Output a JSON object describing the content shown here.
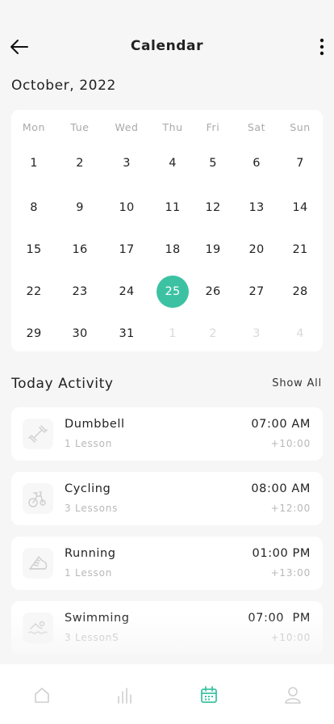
{
  "header": {
    "title": "Calendar",
    "back_icon": "arrow-left-icon",
    "menu_icon": "more-vertical-icon"
  },
  "calendar": {
    "month_label": "October, 2022",
    "weekdays": [
      "Mon",
      "Tue",
      "Wed",
      "Thu",
      "Fri",
      "Sat",
      "Sun"
    ],
    "weeks": [
      [
        "1",
        "2",
        "3",
        "4",
        "5",
        "6",
        "7"
      ],
      [
        "8",
        "9",
        "10",
        "11",
        "12",
        "13",
        "14"
      ],
      [
        "15",
        "16",
        "17",
        "18",
        "19",
        "20",
        "21"
      ],
      [
        "22",
        "23",
        "24",
        "25",
        "26",
        "27",
        "28"
      ],
      [
        "29",
        "30",
        "31",
        "1",
        "2",
        "3",
        "4"
      ]
    ],
    "next_month_days": [
      "1",
      "2",
      "3",
      "4"
    ],
    "selected_day": "25",
    "accent_color": "#3cc2a3"
  },
  "activity": {
    "title": "Today Activity",
    "show_all_label": "Show All",
    "items": [
      {
        "name": "Dumbbell",
        "sub": "1 Lesson",
        "time": "07:00 AM",
        "offset": "+10:00",
        "icon": "dumbbell-icon"
      },
      {
        "name": "Cycling",
        "sub": "3 Lessons",
        "time": "08:00 AM",
        "offset": "+12:00",
        "icon": "bike-icon"
      },
      {
        "name": "Running",
        "sub": "1 Lesson",
        "time": "01:00 PM",
        "offset": "+13:00",
        "icon": "running-shoe-icon"
      },
      {
        "name": "Swimming",
        "sub": "3 LessonS",
        "time": "07:00  PM",
        "offset": "+10:00",
        "icon": "swimming-icon"
      }
    ]
  },
  "bottom_nav": {
    "items": [
      {
        "icon": "home-icon",
        "active": false
      },
      {
        "icon": "stats-icon",
        "active": false
      },
      {
        "icon": "calendar-icon",
        "active": true
      },
      {
        "icon": "profile-icon",
        "active": false
      }
    ],
    "active_color": "#3cc2a3",
    "inactive_color": "#cfcfcf"
  }
}
